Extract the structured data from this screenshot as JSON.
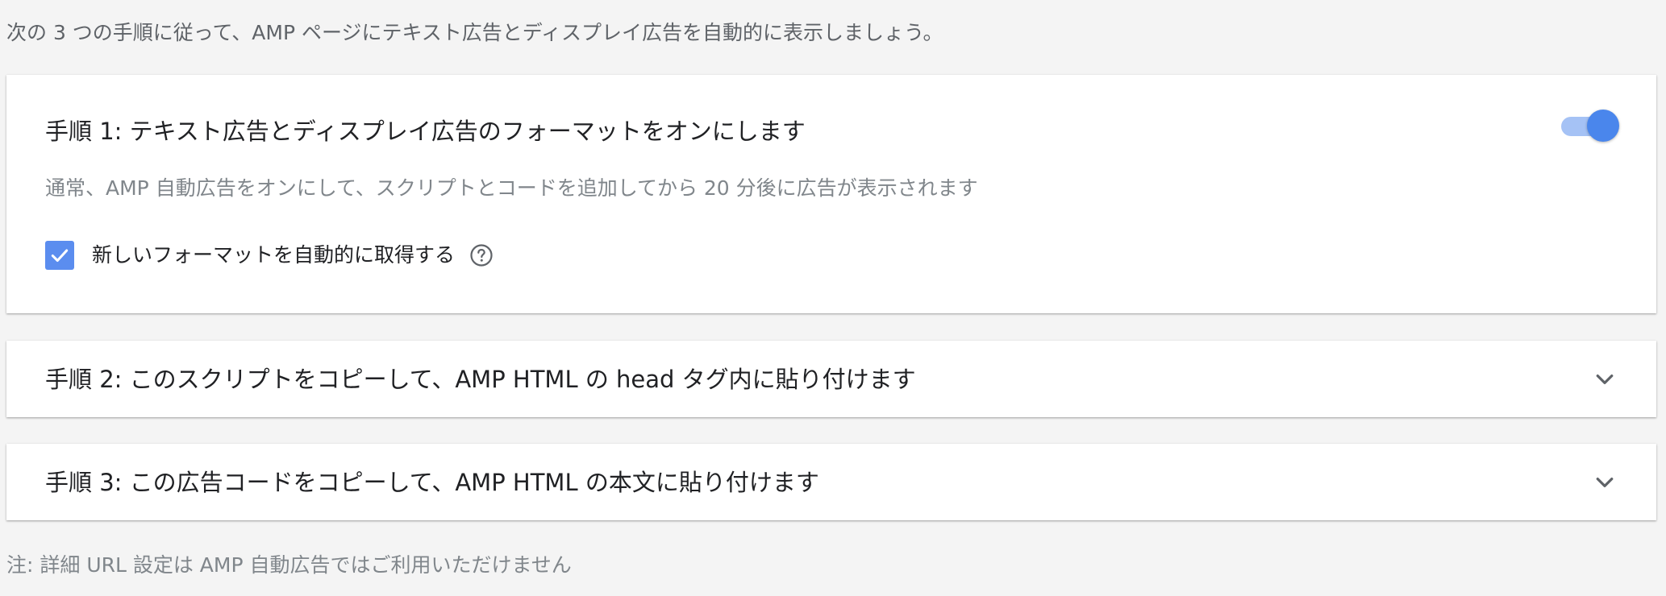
{
  "intro": "次の 3 つの手順に従って、AMP ページにテキスト広告とディスプレイ広告を自動的に表示しましょう。",
  "steps": [
    {
      "title": "手順 1: テキスト広告とディスプレイ広告のフォーマットをオンにします",
      "description": "通常、AMP 自動広告をオンにして、スクリプトとコードを追加してから 20 分後に広告が表示されます",
      "toggle_on": true,
      "checkbox_label": "新しいフォーマットを自動的に取得する",
      "checkbox_checked": true,
      "icons": {
        "toggle": "toggle-switch-icon",
        "checkbox": "checkmark-icon",
        "help": "help-circle-icon"
      }
    },
    {
      "title": "手順 2: このスクリプトをコピーして、AMP HTML の head タグ内に貼り付けます",
      "expanded": false,
      "icon": "chevron-down-icon"
    },
    {
      "title": "手順 3: この広告コードをコピーして、AMP HTML の本文に貼り付けます",
      "expanded": false,
      "icon": "chevron-down-icon"
    }
  ],
  "note": "注: 詳細 URL 設定は AMP 自動広告ではご利用いただけません",
  "colors": {
    "background": "#f4f4f4",
    "accent": "#4a86ec",
    "toggle_track": "#a5c2f5",
    "checkbox": "#5b8def"
  }
}
